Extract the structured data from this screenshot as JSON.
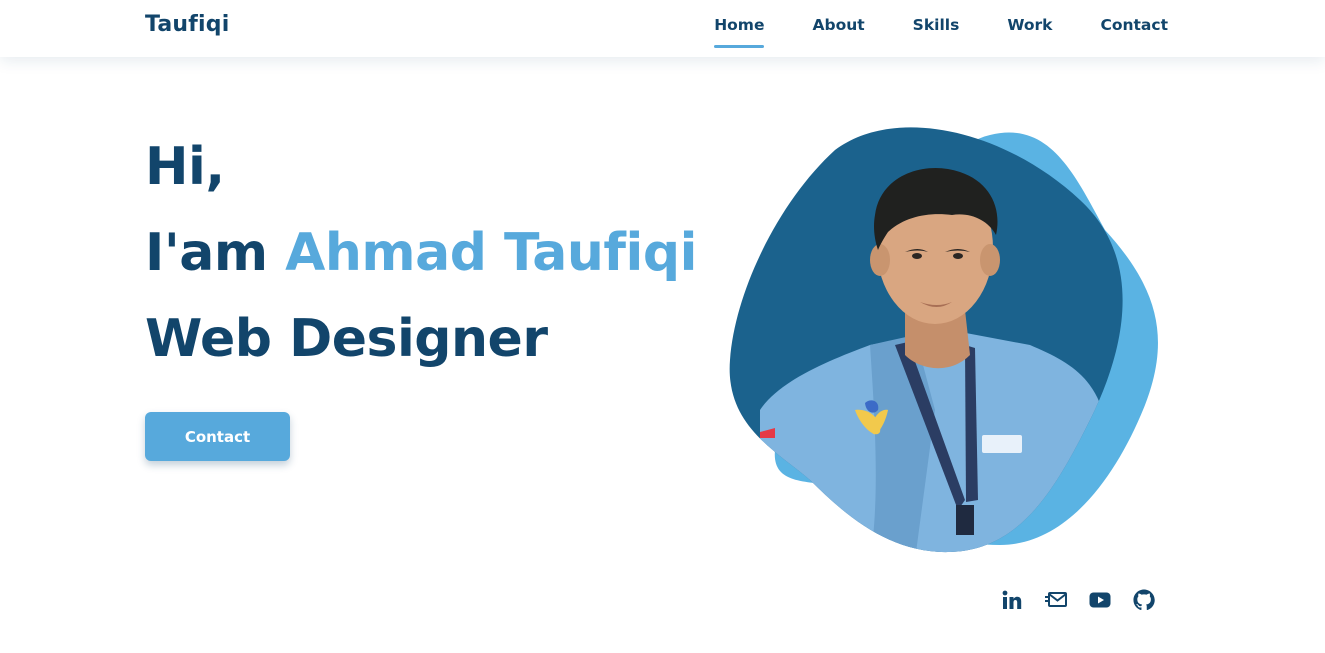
{
  "header": {
    "logo": "Taufiqi",
    "nav": [
      {
        "label": "Home",
        "active": true
      },
      {
        "label": "About"
      },
      {
        "label": "Skills"
      },
      {
        "label": "Work"
      },
      {
        "label": "Contact"
      }
    ]
  },
  "hero": {
    "greeting": "Hi,",
    "intro_prefix": "I'am ",
    "name": "Ahmad Taufiqi",
    "role": "Web Designer",
    "button_label": "Contact"
  },
  "social": [
    {
      "icon": "linkedin-icon"
    },
    {
      "icon": "mail-icon"
    },
    {
      "icon": "youtube-icon"
    },
    {
      "icon": "github-icon"
    }
  ],
  "colors": {
    "primary": "#12456b",
    "accent": "#57a9dc",
    "blob_dark": "#1b628d",
    "blob_light": "#5ab3e3",
    "shirt": "#7fb4df"
  }
}
